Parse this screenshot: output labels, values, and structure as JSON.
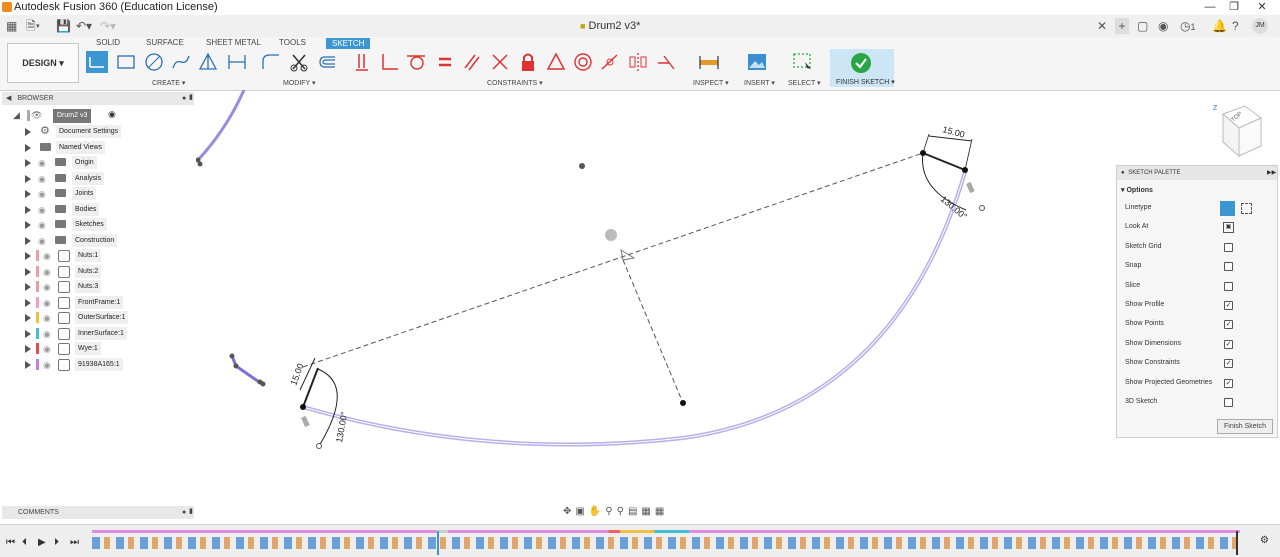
{
  "app": {
    "title": "Autodesk Fusion 360 (Education License)"
  },
  "document": {
    "tab_title": "Drum2 v3*"
  },
  "user": {
    "initials": "JM",
    "job_count": "1"
  },
  "workspace": {
    "label": "DESIGN"
  },
  "toolbar": {
    "tabs": [
      "SOLID",
      "SURFACE",
      "SHEET METAL",
      "TOOLS",
      "SKETCH"
    ],
    "active_tab": "SKETCH",
    "groups": {
      "create": "CREATE",
      "modify": "MODIFY",
      "constraints": "CONSTRAINTS",
      "inspect": "INSPECT",
      "insert": "INSERT",
      "select": "SELECT",
      "finish": "FINISH SKETCH"
    }
  },
  "browser": {
    "title": "BROWSER",
    "root": "Drum2 v3",
    "items": [
      {
        "label": "Document Settings",
        "icon": "gear-icon",
        "color": ""
      },
      {
        "label": "Named Views",
        "icon": "folder-icon",
        "color": ""
      },
      {
        "label": "Origin",
        "icon": "folder-icon",
        "color": ""
      },
      {
        "label": "Analysis",
        "icon": "folder-icon",
        "color": ""
      },
      {
        "label": "Joints",
        "icon": "folder-icon",
        "color": ""
      },
      {
        "label": "Bodies",
        "icon": "folder-icon",
        "color": ""
      },
      {
        "label": "Sketches",
        "icon": "folder-icon",
        "color": ""
      },
      {
        "label": "Construction",
        "icon": "folder-icon",
        "color": ""
      },
      {
        "label": "Nuts:1",
        "icon": "component-icon",
        "color": "#e8a0a0"
      },
      {
        "label": "Nuts:2",
        "icon": "component-icon",
        "color": "#e8a0a0"
      },
      {
        "label": "Nuts:3",
        "icon": "component-icon",
        "color": "#e8a0a0"
      },
      {
        "label": "FrontFrame:1",
        "icon": "component-icon",
        "color": "#f0a0c0"
      },
      {
        "label": "OuterSurface:1",
        "icon": "component-icon",
        "color": "#f0c040"
      },
      {
        "label": "InnerSurface:1",
        "icon": "component-icon",
        "color": "#40c0d0"
      },
      {
        "label": "Wye:1",
        "icon": "component-icon",
        "color": "#e05050"
      },
      {
        "label": "91938A165:1",
        "icon": "component-icon",
        "color": "#c080e0"
      }
    ]
  },
  "sketch": {
    "dimensions": {
      "top_length": "15.00",
      "top_angle": "130.00°",
      "bottom_length": "15.00",
      "bottom_angle": "130.00°"
    }
  },
  "palette": {
    "title": "SKETCH PALETTE",
    "section": "Options",
    "rows": [
      {
        "label": "Linetype",
        "type": "linetype"
      },
      {
        "label": "Look At",
        "type": "button"
      },
      {
        "label": "Sketch Grid",
        "checked": false
      },
      {
        "label": "Snap",
        "checked": false
      },
      {
        "label": "Slice",
        "checked": false
      },
      {
        "label": "Show Profile",
        "checked": true
      },
      {
        "label": "Show Points",
        "checked": true
      },
      {
        "label": "Show Dimensions",
        "checked": true
      },
      {
        "label": "Show Constraints",
        "checked": true
      },
      {
        "label": "Show Projected Geometries",
        "checked": true
      },
      {
        "label": "3D Sketch",
        "checked": false
      }
    ],
    "finish_button": "Finish Sketch"
  },
  "comments": {
    "title": "COMMENTS"
  },
  "colors": {
    "accent": "#3c96d2",
    "sketch_line": "#7a70d8",
    "finish_green": "#27a744"
  }
}
